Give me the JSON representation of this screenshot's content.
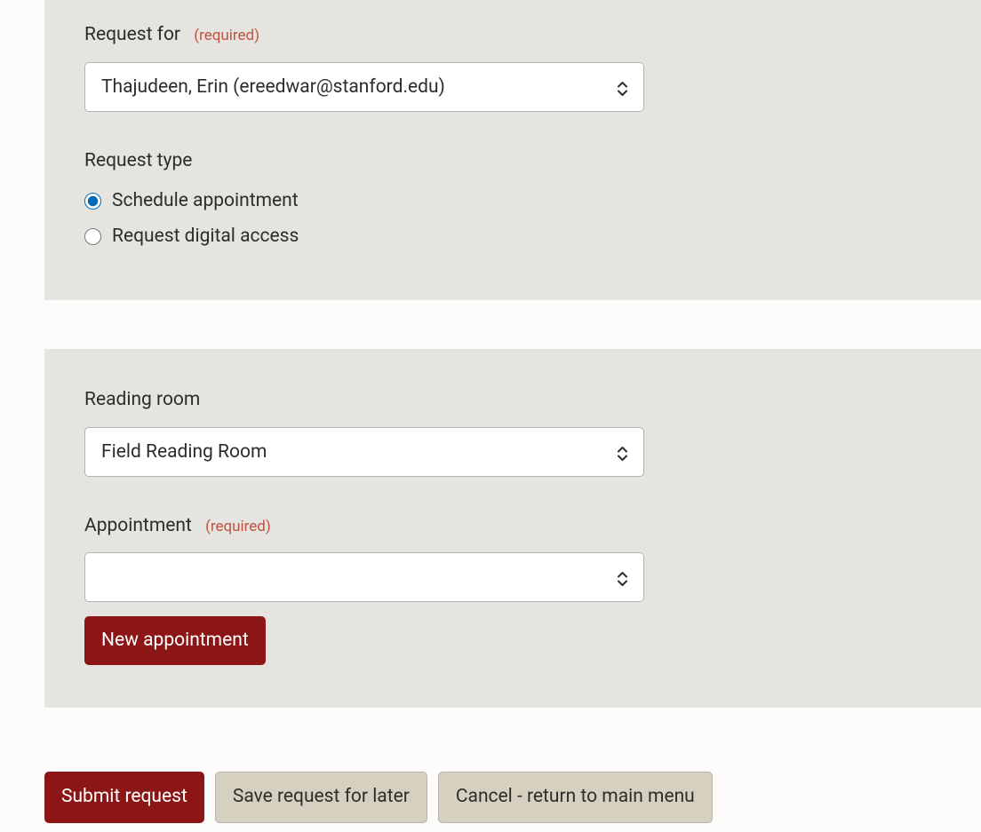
{
  "request_for": {
    "label": "Request for",
    "required_text": "(required)",
    "selected_value": "Thajudeen, Erin (ereedwar@stanford.edu)"
  },
  "request_type": {
    "label": "Request type",
    "options": [
      {
        "label": "Schedule appointment",
        "value": "schedule",
        "checked": true
      },
      {
        "label": "Request digital access",
        "value": "digital",
        "checked": false
      }
    ]
  },
  "reading_room": {
    "label": "Reading room",
    "selected_value": "Field Reading Room"
  },
  "appointment": {
    "label": "Appointment",
    "required_text": "(required)",
    "selected_value": ""
  },
  "buttons": {
    "new_appointment": "New appointment",
    "submit": "Submit request",
    "save_later": "Save request for later",
    "cancel": "Cancel - return to main menu"
  }
}
